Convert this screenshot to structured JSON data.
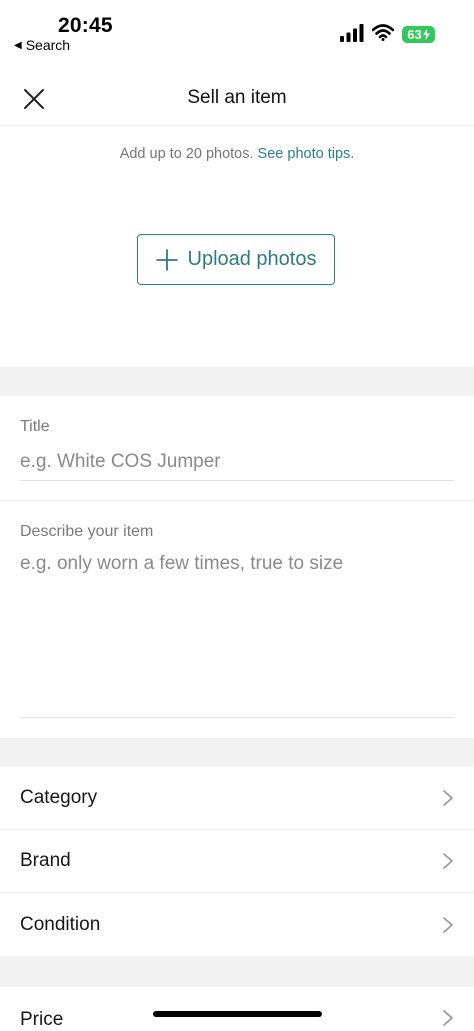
{
  "status_bar": {
    "time": "20:45",
    "back_label": "Search",
    "back_glyph": "◀",
    "battery": "63",
    "battery_icon": "charging-bolt-icon"
  },
  "header": {
    "title": "Sell an item",
    "close_icon": "close-icon"
  },
  "photos": {
    "hint_text": "Add up to 20 photos.",
    "tips_link": "See photo tips.",
    "upload_label": "Upload photos",
    "upload_icon": "plus-icon"
  },
  "form": {
    "title_label": "Title",
    "title_placeholder": "e.g. White COS Jumper",
    "description_label": "Describe your item",
    "description_placeholder": "e.g. only worn a few times, true to size"
  },
  "options": [
    {
      "label": "Category"
    },
    {
      "label": "Brand"
    },
    {
      "label": "Condition"
    },
    {
      "label": "Price"
    }
  ],
  "colors": {
    "accent": "#2d7c84",
    "divider_band": "#f2f2f2",
    "battery": "#34c759"
  }
}
